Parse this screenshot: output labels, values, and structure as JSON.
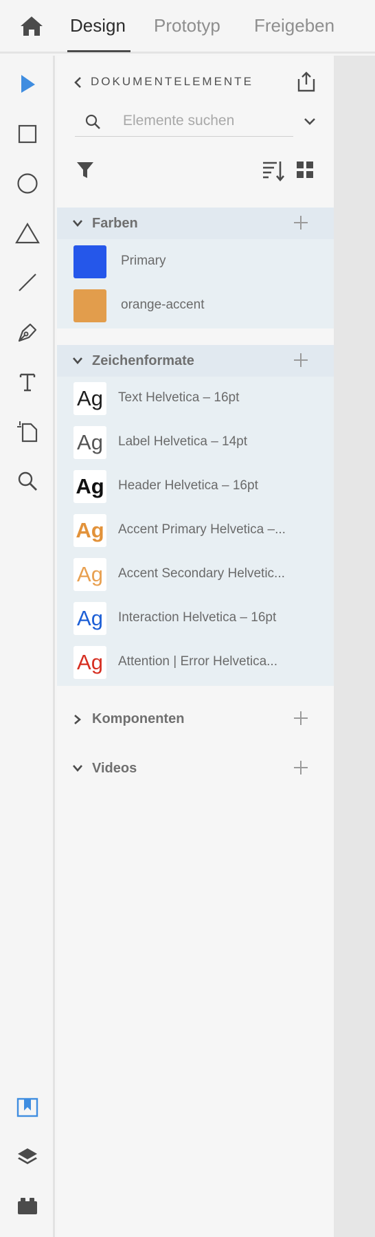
{
  "topbar": {
    "home_icon": "home-icon",
    "tabs": [
      {
        "label": "Design",
        "active": true
      },
      {
        "label": "Prototyp",
        "active": false
      },
      {
        "label": "Freigeben",
        "active": false
      }
    ]
  },
  "toolbar": {
    "tools": [
      "select-arrow-icon",
      "rectangle-icon",
      "ellipse-icon",
      "triangle-icon",
      "line-icon",
      "pen-icon",
      "text-icon",
      "artboard-icon",
      "zoom-icon"
    ],
    "bottom": [
      "document-assets-icon",
      "layers-icon",
      "plugins-icon"
    ],
    "accent_color": "#3f8de0"
  },
  "panel": {
    "title": "DOKUMENTELEMENTE",
    "search": {
      "placeholder": "Elemente suchen",
      "value": ""
    },
    "sections": {
      "colors": {
        "title": "Farben",
        "items": [
          {
            "label": "Primary",
            "color": "#2557ea"
          },
          {
            "label": "orange-accent",
            "color": "#e29d4c"
          }
        ]
      },
      "character_styles": {
        "title": "Zeichenformate",
        "items": [
          {
            "sample": "Ag",
            "label": "Text Helvetica – 16pt",
            "color": "#1e1e1e",
            "weight": "normal"
          },
          {
            "sample": "Ag",
            "label": "Label Helvetica – 14pt",
            "color": "#555555",
            "weight": "normal"
          },
          {
            "sample": "Ag",
            "label": "Header Helvetica – 16pt",
            "color": "#111111",
            "weight": "bold"
          },
          {
            "sample": "Ag",
            "label": "Accent Primary Helvetica –...",
            "color": "#e2923a",
            "weight": "bold"
          },
          {
            "sample": "Ag",
            "label": "Accent Secondary Helvetic...",
            "color": "#e8a050",
            "weight": "normal"
          },
          {
            "sample": "Ag",
            "label": "Interaction Helvetica – 16pt",
            "color": "#1d5fd6",
            "weight": "normal"
          },
          {
            "sample": "Ag",
            "label": "Attention | Error Helvetica...",
            "color": "#d62f22",
            "weight": "normal"
          }
        ]
      },
      "components": {
        "title": "Komponenten",
        "expanded": false
      },
      "videos": {
        "title": "Videos",
        "expanded": true
      }
    }
  }
}
